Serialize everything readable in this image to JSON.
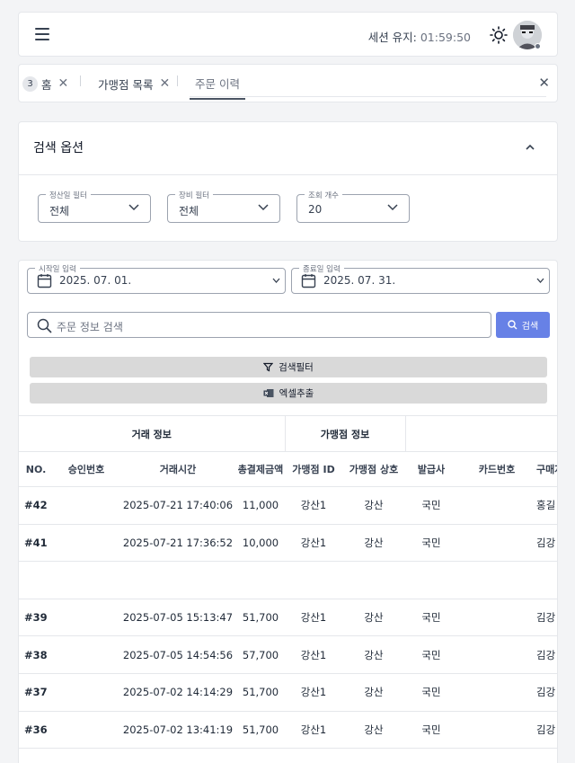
{
  "header": {
    "session_label": "세션 유지:",
    "session_time": "01:59:50"
  },
  "tabs": {
    "badge_count": "3",
    "items": [
      {
        "label": "홈"
      },
      {
        "label": "가맹점 목록"
      },
      {
        "label": "주문 이력"
      }
    ]
  },
  "search_options": {
    "title": "검색 옵션",
    "filters": [
      {
        "label": "정산일 필터",
        "value": "전체"
      },
      {
        "label": "장비 필터",
        "value": "전체"
      },
      {
        "label": "조회 개수",
        "value": "20"
      }
    ]
  },
  "main": {
    "start_date": {
      "label": "시작일 입력",
      "value": "2025. 07. 01."
    },
    "end_date": {
      "label": "종료일 입력",
      "value": "2025. 07. 31."
    },
    "search_placeholder": "주문 정보 검색",
    "search_button": "검색",
    "filter_button": "검색필터",
    "excel_button": "엑셀추출"
  },
  "table": {
    "groups": [
      "거래 정보",
      "가맹점 정보"
    ],
    "columns": [
      "NO.",
      "승인번호",
      "거래시간",
      "총결제금액",
      "가맹점 ID",
      "가맹점 상호",
      "발급사",
      "카드번호",
      "구매자"
    ],
    "rows": [
      {
        "no": "#42",
        "approval": "",
        "time": "2025-07-21 17:40:06",
        "amount": "11,000",
        "mid": "강산1",
        "mname": "강산",
        "issuer": "국민",
        "card": "",
        "buyer": "홍길"
      },
      {
        "no": "#41",
        "approval": "",
        "time": "2025-07-21 17:36:52",
        "amount": "10,000",
        "mid": "강산1",
        "mname": "강산",
        "issuer": "국민",
        "card": "",
        "buyer": "김강"
      },
      {
        "no": "",
        "approval": "",
        "time": "",
        "amount": "",
        "mid": "",
        "mname": "",
        "issuer": "",
        "card": "",
        "buyer": ""
      },
      {
        "no": "#39",
        "approval": "",
        "time": "2025-07-05 15:13:47",
        "amount": "51,700",
        "mid": "강산1",
        "mname": "강산",
        "issuer": "국민",
        "card": "",
        "buyer": "김강"
      },
      {
        "no": "#38",
        "approval": "",
        "time": "2025-07-05 14:54:56",
        "amount": "57,700",
        "mid": "강산1",
        "mname": "강산",
        "issuer": "국민",
        "card": "",
        "buyer": "김강"
      },
      {
        "no": "#37",
        "approval": "",
        "time": "2025-07-02 14:14:29",
        "amount": "51,700",
        "mid": "강산1",
        "mname": "강산",
        "issuer": "국민",
        "card": "",
        "buyer": "김강"
      },
      {
        "no": "#36",
        "approval": "",
        "time": "2025-07-02 13:41:19",
        "amount": "51,700",
        "mid": "강산1",
        "mname": "강산",
        "issuer": "국민",
        "card": "",
        "buyer": "김강"
      }
    ]
  }
}
